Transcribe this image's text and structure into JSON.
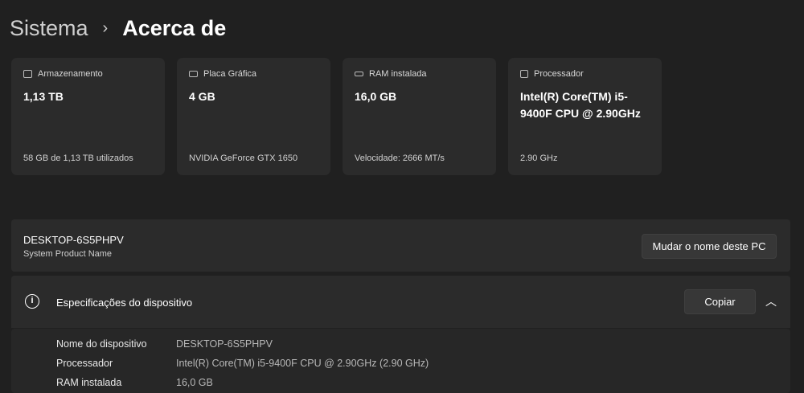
{
  "breadcrumb": {
    "parent": "Sistema",
    "current": "Acerca de"
  },
  "cards": [
    {
      "label": "Armazenamento",
      "icon": "hard-drive-icon",
      "value": "1,13 TB",
      "sub": "58 GB de 1,13 TB utilizados"
    },
    {
      "label": "Placa Gráfica",
      "icon": "gpu-icon",
      "value": "4 GB",
      "sub": "NVIDIA GeForce GTX 1650"
    },
    {
      "label": "RAM instalada",
      "icon": "ram-icon",
      "value": "16,0 GB",
      "sub": "Velocidade: 2666 MT/s"
    },
    {
      "label": "Processador",
      "icon": "cpu-icon",
      "value": "Intel(R) Core(TM) i5-9400F CPU @ 2.90GHz",
      "sub": "2.90 GHz"
    }
  ],
  "pc": {
    "name": "DESKTOP-6S5PHPV",
    "model": "System Product Name",
    "rename_label": "Mudar o nome deste PC"
  },
  "specs": {
    "title": "Especificações do dispositivo",
    "copy_label": "Copiar",
    "rows": [
      {
        "key": "Nome do dispositivo",
        "value": "DESKTOP-6S5PHPV"
      },
      {
        "key": "Processador",
        "value": "Intel(R) Core(TM) i5-9400F CPU @ 2.90GHz (2.90 GHz)"
      },
      {
        "key": "RAM instalada",
        "value": "16,0 GB"
      }
    ]
  }
}
